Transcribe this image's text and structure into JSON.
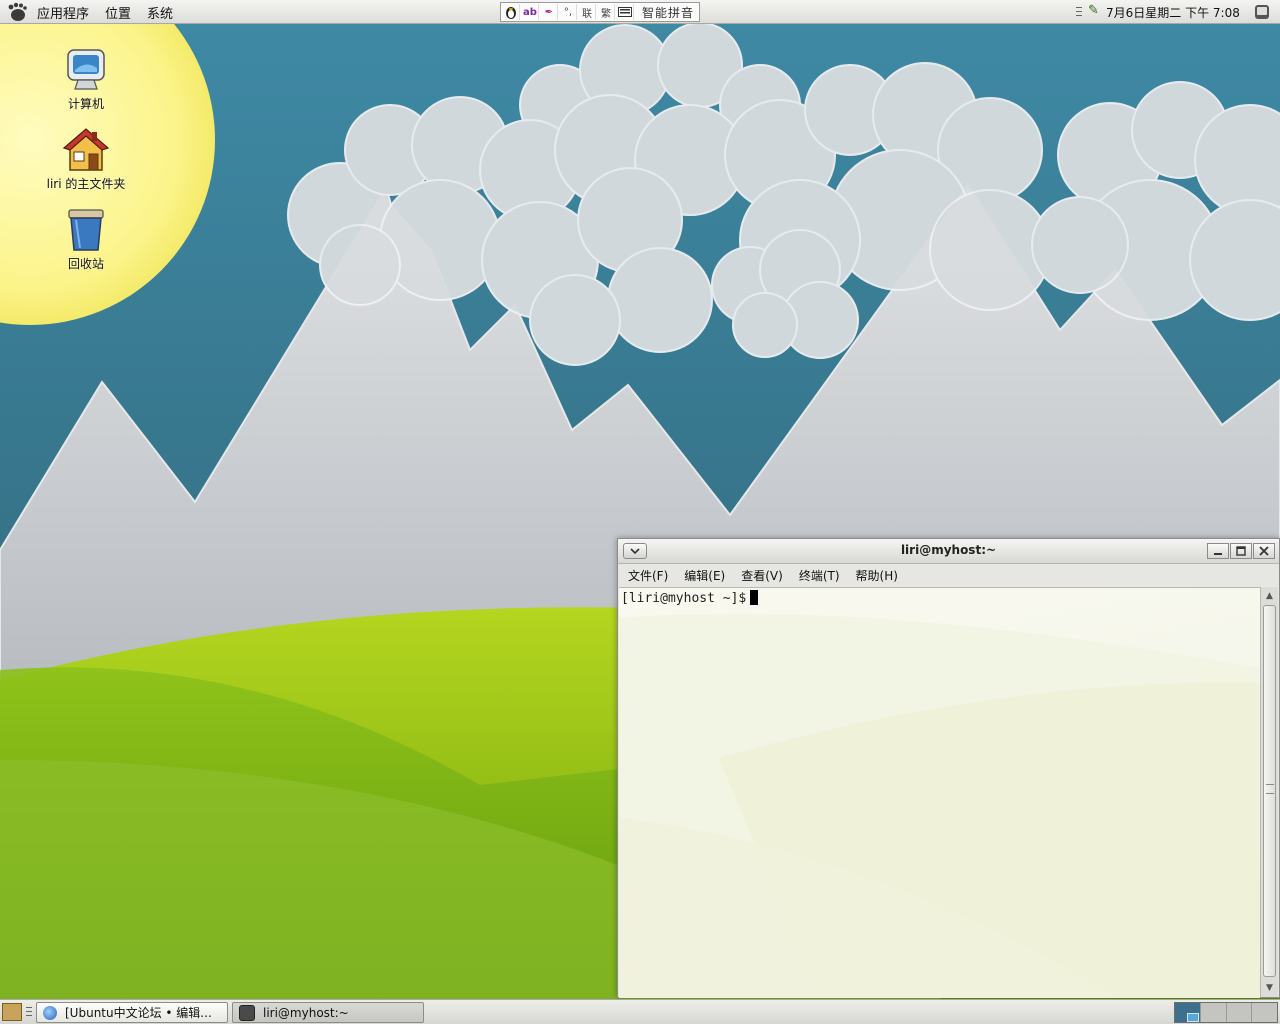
{
  "top_panel": {
    "menus": [
      "应用程序",
      "位置",
      "系统"
    ],
    "ime": {
      "buttons": [
        "penguin-icon",
        "ab-icon",
        "feather-icon",
        "symbol-icon",
        "联",
        "繁",
        "keyboard-icon"
      ],
      "label": "智能拼音"
    },
    "clock": "7月6日星期二 下午 7:08"
  },
  "desktop": {
    "icons": [
      {
        "label": "计算机",
        "icon": "computer-icon"
      },
      {
        "label": "liri 的主文件夹",
        "icon": "home-folder-icon"
      },
      {
        "label": "回收站",
        "icon": "trash-icon"
      }
    ]
  },
  "terminal": {
    "title": "liri@myhost:~",
    "menus": [
      "文件(F)",
      "编辑(E)",
      "查看(V)",
      "终端(T)",
      "帮助(H)"
    ],
    "prompt": "[liri@myhost ~]$"
  },
  "bottom_panel": {
    "tasks": [
      {
        "label": "[Ubuntu中文论坛 • 编辑...",
        "icon": "firefox-icon"
      },
      {
        "label": "liri@myhost:~",
        "icon": "terminal-icon"
      }
    ],
    "workspaces": 4,
    "active_workspace": 1
  },
  "colors": {
    "sky": "#4a8fa6",
    "sun": "#fbf7a0",
    "mountain": "#b8bcc2",
    "grass": "#7fb319",
    "terminal_bg": "#f5f6ea"
  }
}
